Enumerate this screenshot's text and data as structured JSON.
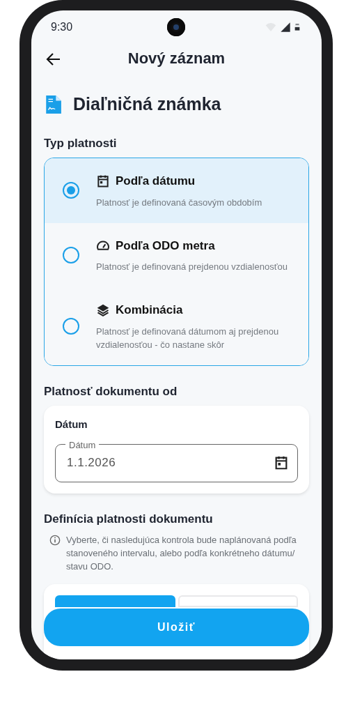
{
  "status_bar": {
    "time": "9:30"
  },
  "app_bar": {
    "title": "Nový záznam"
  },
  "document": {
    "title": "Diaľničná známka"
  },
  "validity_type": {
    "heading": "Typ platnosti",
    "options": [
      {
        "kind": "date",
        "title": "Podľa dátumu",
        "description": "Platnosť je definovaná časovým obdobím",
        "selected": true
      },
      {
        "kind": "odo",
        "title": "Podľa ODO metra",
        "description": "Platnosť je definovaná prejdenou vzdialenosťou",
        "selected": false
      },
      {
        "kind": "combo",
        "title": "Kombinácia",
        "description": "Platnosť je definovaná dátumom aj prejdenou vzdialenosťou - čo nastane skôr",
        "selected": false
      }
    ]
  },
  "valid_from": {
    "heading": "Platnosť dokumentu od",
    "card_label": "Dátum",
    "field": {
      "label": "Dátum",
      "value": "1.1.2026"
    }
  },
  "definition": {
    "heading": "Definícia platnosti dokumentu",
    "info": "Vyberte, či nasledujúca kontrola bude naplánovaná podľa stanoveného intervalu, alebo podľa konkrétneho dátumu/ stavu ODO.",
    "tabs": [
      {
        "selected": true
      },
      {
        "selected": false
      }
    ]
  },
  "save_button": "Uložiť"
}
